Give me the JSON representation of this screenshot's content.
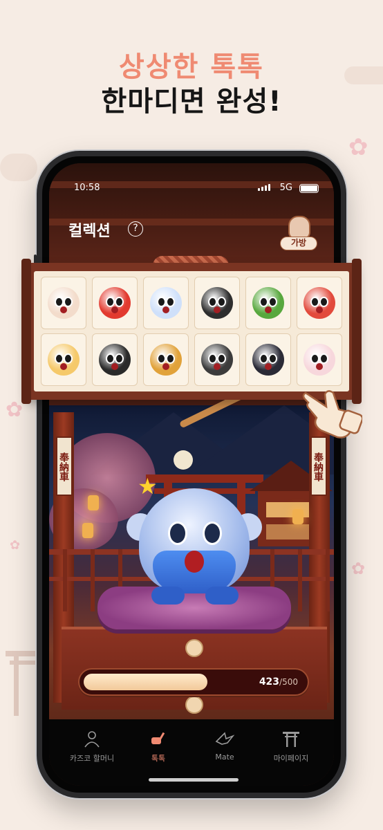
{
  "headline": {
    "line1": "상상한 톡톡",
    "line2": "한마디면 완성!"
  },
  "status": {
    "time": "10:58",
    "network": "5G"
  },
  "screen": {
    "title": "컬렉션",
    "help_symbol": "?",
    "bag_label": "가방"
  },
  "collection": {
    "items": [
      {
        "name": "bear-plush",
        "color": "#f3dccb"
      },
      {
        "name": "lion-dancer",
        "color": "#e23a2f"
      },
      {
        "name": "blue-ghost",
        "color": "#cfe0fa"
      },
      {
        "name": "black-cat",
        "color": "#2e2e2e"
      },
      {
        "name": "green-turtle",
        "color": "#58a83e"
      },
      {
        "name": "red-dragon",
        "color": "#e24a3c"
      },
      {
        "name": "cream-cake",
        "color": "#f5c96a"
      },
      {
        "name": "black-ninja",
        "color": "#2a2a2a"
      },
      {
        "name": "golden-warrior",
        "color": "#e1a23a"
      },
      {
        "name": "gorilla",
        "color": "#3c3c3c"
      },
      {
        "name": "penguin",
        "color": "#2a2a36"
      },
      {
        "name": "strawberry-cake",
        "color": "#f7d7dc"
      }
    ]
  },
  "plaques": {
    "left": "奉納車",
    "right": "奉納車"
  },
  "progress": {
    "current": "423",
    "total": "/500",
    "value": 423,
    "max": 500
  },
  "nav": {
    "items": [
      {
        "label": "카즈코 할머니",
        "icon": "grandma-icon"
      },
      {
        "label": "톡톡",
        "icon": "mallet-icon",
        "active": true
      },
      {
        "label": "Mate",
        "icon": "paper-crane-icon"
      },
      {
        "label": "마이페이지",
        "icon": "torii-icon"
      }
    ]
  },
  "colors": {
    "accent": "#f08a72",
    "headline_dark": "#161616"
  }
}
